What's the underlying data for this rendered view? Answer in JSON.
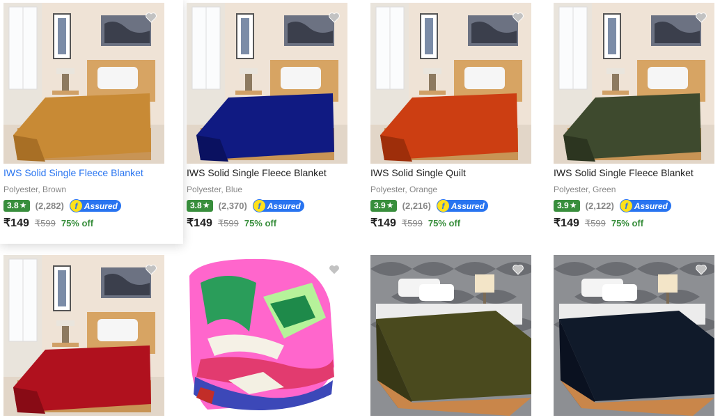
{
  "products": [
    {
      "title": "IWS Solid Single Fleece Blanket",
      "subtitle": "Polyester, Brown",
      "rating": "3.8",
      "rating_count": "(2,282)",
      "assured_label": "Assured",
      "price": "₹149",
      "mrp": "₹599",
      "discount": "75% off",
      "color": "#c88a35",
      "image": "bedroom-brown"
    },
    {
      "title": "IWS Solid Single Fleece Blanket",
      "subtitle": "Polyester, Blue",
      "rating": "3.8",
      "rating_count": "(2,370)",
      "assured_label": "Assured",
      "price": "₹149",
      "mrp": "₹599",
      "discount": "75% off",
      "color": "#101a82",
      "image": "bedroom-blue"
    },
    {
      "title": "IWS Solid Single Quilt",
      "subtitle": "Polyester, Orange",
      "rating": "3.9",
      "rating_count": "(2,216)",
      "assured_label": "Assured",
      "price": "₹149",
      "mrp": "₹599",
      "discount": "75% off",
      "color": "#cc3e12",
      "image": "bedroom-orange"
    },
    {
      "title": "IWS Solid Single Fleece Blanket",
      "subtitle": "Polyester, Green",
      "rating": "3.9",
      "rating_count": "(2,122)",
      "assured_label": "Assured",
      "price": "₹149",
      "mrp": "₹599",
      "discount": "75% off",
      "color": "#3e4a2e",
      "image": "bedroom-green"
    },
    {
      "color": "#b0111e",
      "image": "bedroom-red"
    },
    {
      "image": "folded-printed-blanket"
    },
    {
      "color": "#4a4a1e",
      "image": "pattern-wall-olive"
    },
    {
      "color": "#101a2a",
      "image": "pattern-wall-navy"
    }
  ]
}
